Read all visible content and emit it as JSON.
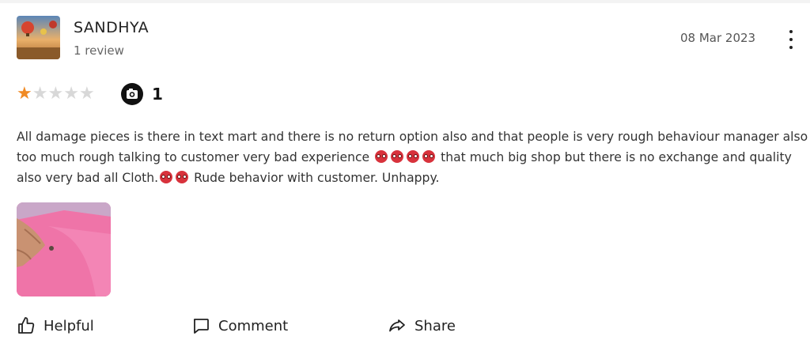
{
  "review": {
    "author_name": "SANDHYA",
    "author_meta": "1 review",
    "date": "08 Mar 2023",
    "rating": 1,
    "rating_max": 5,
    "photo_count": "1",
    "text_parts": [
      "All damage pieces is there in text mart and there is no return option also and that people is very rough behaviour manager also too much rough talking to customer very bad experience",
      "that much big shop but there is no exchange and quality also very bad all Cloth.",
      "Rude behavior with customer. Unhappy."
    ]
  },
  "actions": {
    "helpful_label": "Helpful",
    "comment_label": "Comment",
    "share_label": "Share"
  },
  "icons": {
    "more": "more-vertical-icon",
    "camera": "camera-icon",
    "helpful": "thumbs-up-icon",
    "comment": "comment-icon",
    "share": "share-icon"
  },
  "colors": {
    "star_active": "#f08a24",
    "star_inactive": "#d8d8d8",
    "emoji": "#d8323c"
  }
}
